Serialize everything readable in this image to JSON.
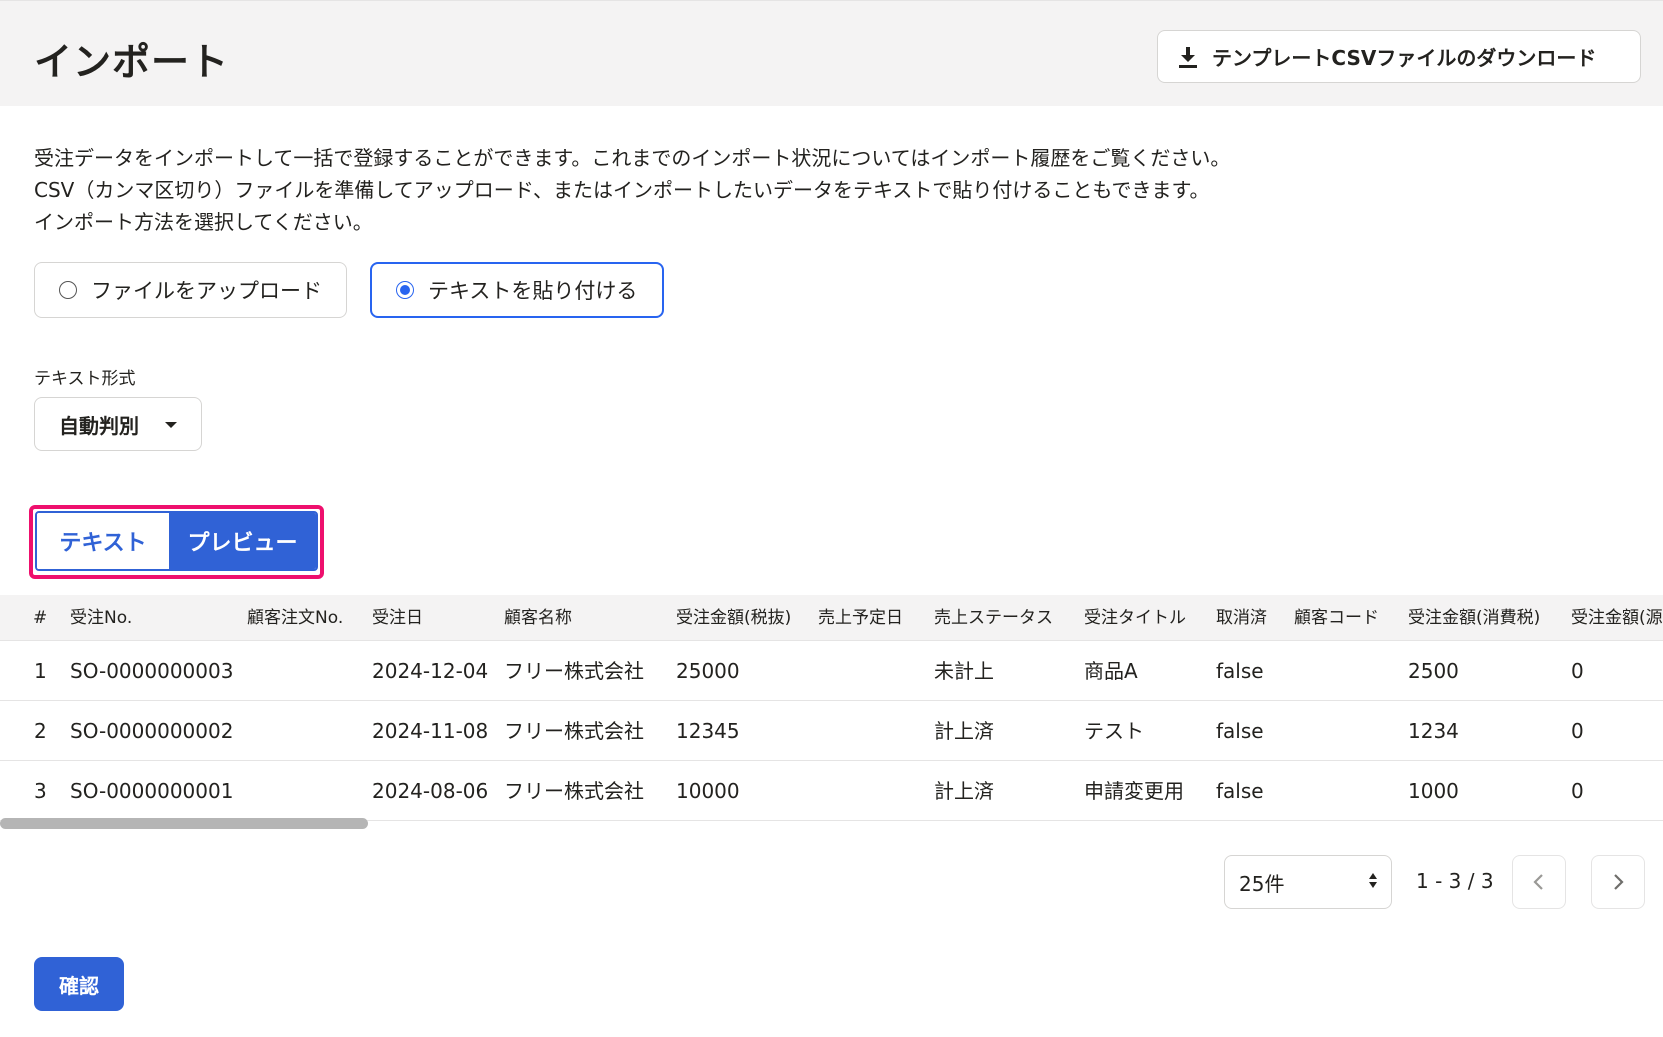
{
  "header": {
    "title": "インポート",
    "download_label": "テンプレートCSVファイルのダウンロード",
    "download_icon": "download-icon"
  },
  "description": {
    "line1": "受注データをインポートして一括で登録することができます。これまでのインポート状況についてはインポート履歴をご覧ください。",
    "line2": "CSV（カンマ区切り）ファイルを準備してアップロード、またはインポートしたいデータをテキストで貼り付けることもできます。",
    "line3": "インポート方法を選択してください。"
  },
  "import_method": {
    "options": [
      {
        "label": "ファイルをアップロード",
        "selected": false
      },
      {
        "label": "テキストを貼り付ける",
        "selected": true
      }
    ]
  },
  "text_format": {
    "label": "テキスト形式",
    "value": "自動判別"
  },
  "view_toggle": {
    "text_label": "テキスト",
    "preview_label": "プレビュー",
    "active": "preview"
  },
  "table": {
    "columns": [
      "#",
      "受注No.",
      "顧客注文No.",
      "受注日",
      "顧客名称",
      "受注金額(税抜)",
      "売上予定日",
      "売上ステータス",
      "受注タイトル",
      "取消済",
      "顧客コード",
      "受注金額(消費税)",
      "受注金額(源"
    ],
    "rows": [
      [
        "1",
        "SO-0000000003",
        "",
        "2024-12-04",
        "フリー株式会社",
        "25000",
        "",
        "未計上",
        "商品A",
        "false",
        "",
        "2500",
        "0"
      ],
      [
        "2",
        "SO-0000000002",
        "",
        "2024-11-08",
        "フリー株式会社",
        "12345",
        "",
        "計上済",
        "テスト",
        "false",
        "",
        "1234",
        "0"
      ],
      [
        "3",
        "SO-0000000001",
        "",
        "2024-08-06",
        "フリー株式会社",
        "10000",
        "",
        "計上済",
        "申請変更用",
        "false",
        "",
        "1000",
        "0"
      ]
    ]
  },
  "pagination": {
    "per_page": "25件",
    "range": "1 - 3 / 3",
    "prev_icon": "chevron-left-icon",
    "next_icon": "chevron-right-icon"
  },
  "confirm_label": "確認",
  "colors": {
    "accent": "#3062d6",
    "highlight": "#ee0f6d",
    "header_bg": "#f4f3f3"
  }
}
